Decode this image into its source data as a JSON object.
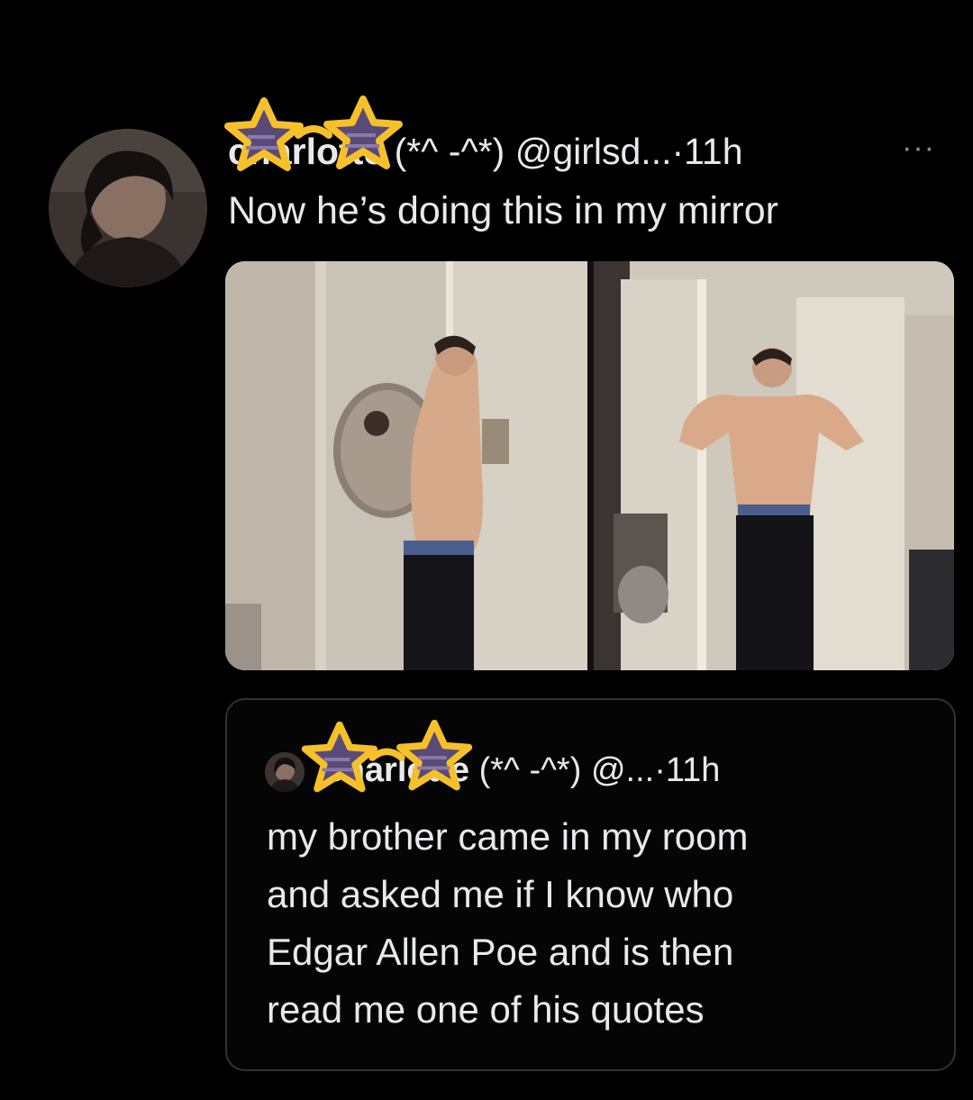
{
  "tweet": {
    "display_name": "charlotte",
    "emoticon": "(*^ -^*)",
    "handle": "@girlsd...",
    "separator": "·",
    "time": "11h",
    "more": "···",
    "text": "Now he’s doing this in my mirror",
    "avatar_icon": "profile-photo",
    "media_count": 2
  },
  "quote": {
    "display_name": "charlotte",
    "emoticon": "(*^ -^*)",
    "handle": "@...",
    "separator": "·",
    "time": "11h",
    "text": "my brother came in my room\nand asked me if I know who\nEdgar Allen Poe and is then\nread me one of his quotes"
  },
  "colors": {
    "background": "#000000",
    "text": "#e7e9ea",
    "muted": "#8b8f93",
    "border": "#2f3336",
    "star_fill": "#5a4a7a",
    "star_outline": "#f5c02a"
  }
}
